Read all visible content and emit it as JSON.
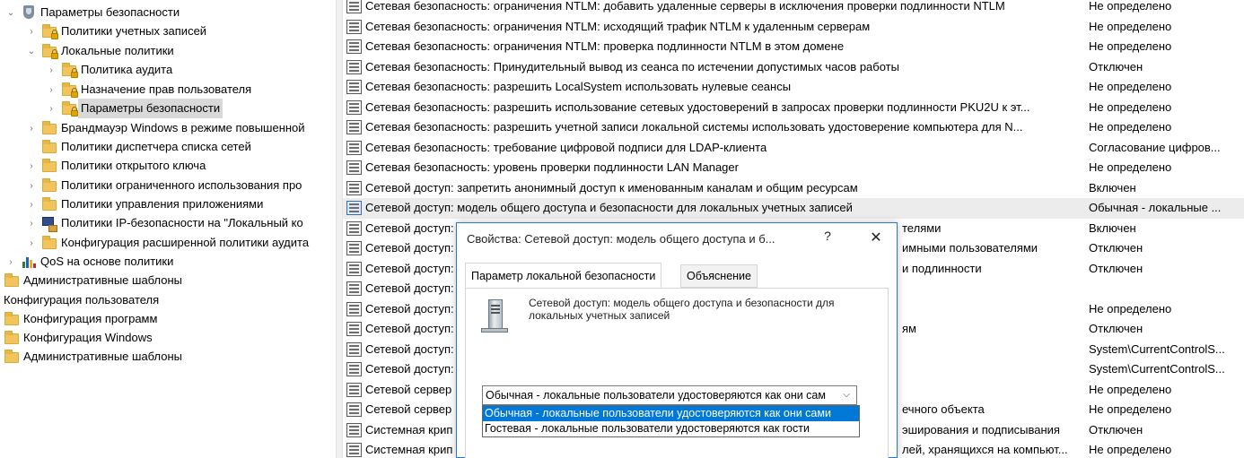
{
  "tree": {
    "items": [
      {
        "label": "Параметры безопасности",
        "chevron": "⌄",
        "icon": "security-folder"
      },
      {
        "label": "Политики учетных записей",
        "chevron": "›",
        "icon": "lock-folder"
      },
      {
        "label": "Локальные политики",
        "chevron": "⌄",
        "icon": "lock-folder"
      },
      {
        "label": "Политика аудита",
        "chevron": "›",
        "icon": "lock-folder"
      },
      {
        "label": "Назначение прав пользователя",
        "chevron": "›",
        "icon": "lock-folder"
      },
      {
        "label": "Параметры безопасности",
        "chevron": "›",
        "icon": "lock-folder"
      },
      {
        "label": "Брандмауэр Windows в режиме повышенной",
        "chevron": "›",
        "icon": "lock-folder"
      },
      {
        "label": "Политики диспетчера списка сетей",
        "chevron": "",
        "icon": "folder"
      },
      {
        "label": "Политики открытого ключа",
        "chevron": "›",
        "icon": "folder"
      },
      {
        "label": "Политики ограниченного использования про",
        "chevron": "›",
        "icon": "folder"
      },
      {
        "label": "Политики управления приложениями",
        "chevron": "›",
        "icon": "folder"
      },
      {
        "label": "Политики IP-безопасности на \"Локальный ко",
        "chevron": "›",
        "icon": "monitor"
      },
      {
        "label": "Конфигурация расширенной политики аудита",
        "chevron": "›",
        "icon": "folder"
      },
      {
        "label": "QoS на основе политики",
        "chevron": "›",
        "icon": "bar-chart"
      },
      {
        "label": "Административные шаблоны",
        "chevron": "",
        "icon": "folder"
      },
      {
        "label": "Конфигурация пользователя",
        "chevron": "",
        "icon": "none"
      },
      {
        "label": "Конфигурация программ",
        "chevron": "",
        "icon": "folder"
      },
      {
        "label": "Конфигурация Windows",
        "chevron": "",
        "icon": "folder"
      },
      {
        "label": "Административные шаблоны",
        "chevron": "",
        "icon": "folder"
      }
    ]
  },
  "policies": [
    {
      "name": "Сетевая безопасность: ограничения NTLM: добавить удаленные серверы в исключения проверки подлинности NTLM",
      "value": "Не определено"
    },
    {
      "name": "Сетевая безопасность: ограничения NTLM: исходящий трафик NTLM к удаленным серверам",
      "value": "Не определено"
    },
    {
      "name": "Сетевая безопасность: ограничения NTLM: проверка подлинности NTLM в этом домене",
      "value": "Не определено"
    },
    {
      "name": "Сетевая безопасность: Принудительный вывод из сеанса по истечении допустимых часов работы",
      "value": "Отключен"
    },
    {
      "name": "Сетевая безопасность: разрешить LocalSystem использовать нулевые сеансы",
      "value": "Не определено"
    },
    {
      "name": "Сетевая безопасность: разрешить использование сетевых удостоверений в запросах проверки подлинности PKU2U к эт...",
      "value": "Не определено"
    },
    {
      "name": "Сетевая безопасность: разрешить учетной записи локальной системы использовать удостоверение компьютера для N...",
      "value": "Не определено"
    },
    {
      "name": "Сетевая безопасность: требование цифровой подписи для LDAP-клиента",
      "value": "Согласование цифров..."
    },
    {
      "name": "Сетевая безопасность: уровень проверки подлинности LAN Manager",
      "value": "Не определено"
    },
    {
      "name": "Сетевой доступ: запретить анонимный доступ к именованным каналам и общим ресурсам",
      "value": "Включен"
    },
    {
      "name": "Сетевой доступ: модель общего доступа и безопасности для локальных учетных записей",
      "value": "Обычная - локальные ..."
    },
    {
      "name": "Сетевой доступ:",
      "tail": "телями",
      "value": "Включен"
    },
    {
      "name": "Сетевой доступ:",
      "tail": "имными пользователями",
      "value": "Отключен"
    },
    {
      "name": "Сетевой доступ:",
      "tail": "и подлинности",
      "value": "Отключен"
    },
    {
      "name": "Сетевой доступ:",
      "tail": "",
      "value": ""
    },
    {
      "name": "Сетевой доступ:",
      "tail": "",
      "value": "Не определено"
    },
    {
      "name": "Сетевой доступ:",
      "tail": "ям",
      "value": "Отключен"
    },
    {
      "name": "Сетевой доступ:",
      "tail": "",
      "value": "System\\CurrentControlS..."
    },
    {
      "name": "Сетевой доступ:",
      "tail": "",
      "value": "System\\CurrentControlS..."
    },
    {
      "name": "Сетевой сервер",
      "tail": "",
      "value": "Не определено"
    },
    {
      "name": "Сетевой сервер",
      "tail": "ечного объекта",
      "value": "Не определено"
    },
    {
      "name": "Системная крип",
      "tail": "эширования и подписывания",
      "value": "Отключен"
    },
    {
      "name": "Системная крип",
      "tail": "лей, хранящихся на компьют...",
      "value": "Не определено"
    }
  ],
  "dialog": {
    "title": "Свойства: Сетевой доступ: модель общего доступа и б...",
    "help": "?",
    "close": "✕",
    "tabs": [
      "Параметр локальной безопасности",
      "Объяснение"
    ],
    "description": "Сетевой доступ: модель общего доступа и безопасности для локальных учетных записей",
    "combo_value": "Обычная - локальные пользователи удостоверяются как они сам",
    "combo_arrow": "⌵",
    "options": [
      "Обычная - локальные пользователи удостоверяются как они сами",
      "Гостевая - локальные пользователи удостоверяются как гости"
    ]
  }
}
